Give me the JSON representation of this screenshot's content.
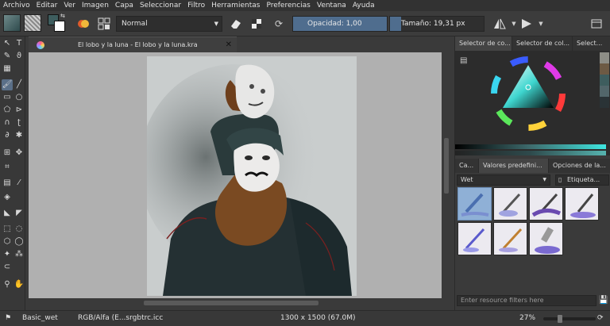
{
  "menu": [
    "Archivo",
    "Editar",
    "Ver",
    "Imagen",
    "Capa",
    "Seleccionar",
    "Filtro",
    "Herramientas",
    "Preferencias",
    "Ventana",
    "Ayuda"
  ],
  "toolbar": {
    "blend_mode": "Normal",
    "opacity_label": "Opacidad:  1,00",
    "opacity_value": 1.0,
    "size_label": "Tamaño:  19,31 px",
    "size_value": 19.31
  },
  "document": {
    "tab_title": "El lobo y la luna - El lobo y la luna.kra",
    "close_icon": "close-icon"
  },
  "right_panel": {
    "top_tabs": [
      "Selector de co...",
      "Selector de col...",
      "Select..."
    ],
    "preset_tabs": [
      "Ca...",
      "Valores predefini...",
      "Opciones de la..."
    ],
    "preset_filter": "Wet",
    "tag_label": "Etiqueta...",
    "search_placeholder": "Enter resource filters here"
  },
  "status": {
    "preset_name": "Basic_wet",
    "color_space": "RGB/Alfa (E...srgbtrc.icc",
    "image_size": "1300 x 1500 (67.0M)",
    "zoom": "27%"
  },
  "colors": {
    "accent": "#4f6d8e",
    "panel": "#3a3a3a",
    "fg_swatch": "#3e5d5e"
  }
}
